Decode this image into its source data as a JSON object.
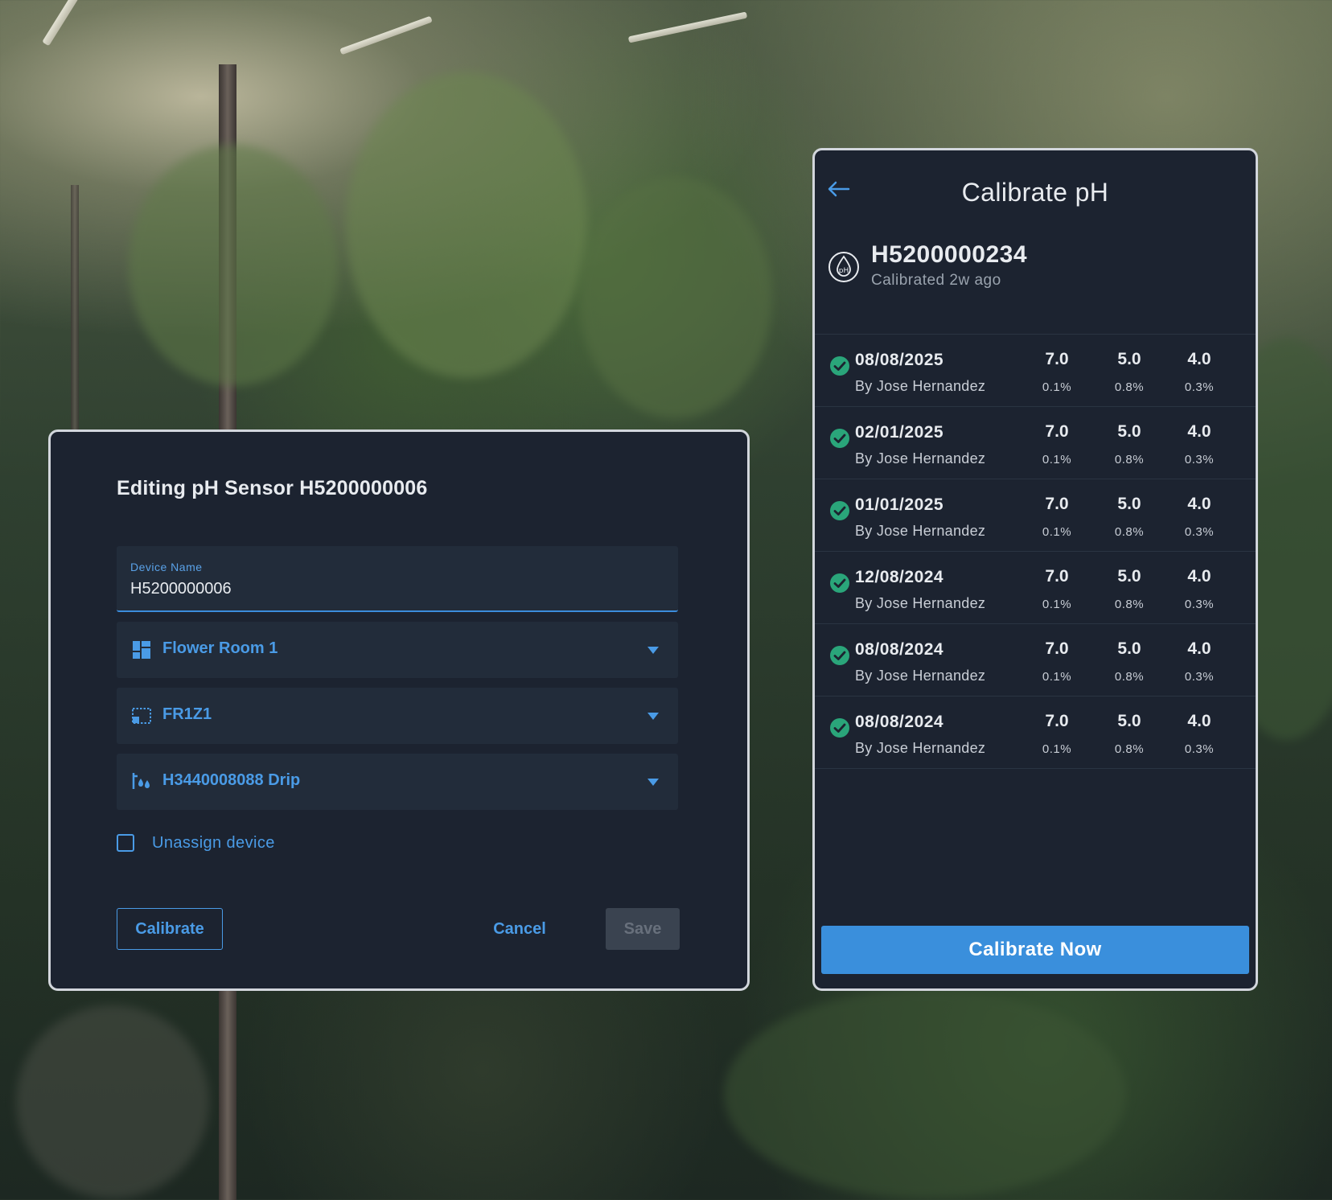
{
  "edit_dialog": {
    "title": "Editing pH Sensor H5200000006",
    "device_name": {
      "label": "Device Name",
      "value": "H5200000006"
    },
    "selects": [
      {
        "icon": "room-grid-icon",
        "value": "Flower Room 1"
      },
      {
        "icon": "zone-icon",
        "value": "FR1Z1"
      },
      {
        "icon": "drip-irrigation-icon",
        "value": "H3440008088 Drip"
      }
    ],
    "unassign_label": "Unassign device",
    "unassign_checked": false,
    "buttons": {
      "calibrate": "Calibrate",
      "cancel": "Cancel",
      "save": "Save"
    }
  },
  "calibrate_panel": {
    "title": "Calibrate pH",
    "device": {
      "icon": "ph-sensor-icon",
      "id": "H5200000234",
      "subtitle": "Calibrated 2w ago"
    },
    "rows": [
      {
        "date": "08/08/2025",
        "by": "By Jose Hernandez",
        "points": [
          {
            "ph": "7.0",
            "dev": "0.1%"
          },
          {
            "ph": "5.0",
            "dev": "0.8%"
          },
          {
            "ph": "4.0",
            "dev": "0.3%"
          }
        ]
      },
      {
        "date": "02/01/2025",
        "by": "By Jose Hernandez",
        "points": [
          {
            "ph": "7.0",
            "dev": "0.1%"
          },
          {
            "ph": "5.0",
            "dev": "0.8%"
          },
          {
            "ph": "4.0",
            "dev": "0.3%"
          }
        ]
      },
      {
        "date": "01/01/2025",
        "by": "By Jose Hernandez",
        "points": [
          {
            "ph": "7.0",
            "dev": "0.1%"
          },
          {
            "ph": "5.0",
            "dev": "0.8%"
          },
          {
            "ph": "4.0",
            "dev": "0.3%"
          }
        ]
      },
      {
        "date": "12/08/2024",
        "by": "By Jose Hernandez",
        "points": [
          {
            "ph": "7.0",
            "dev": "0.1%"
          },
          {
            "ph": "5.0",
            "dev": "0.8%"
          },
          {
            "ph": "4.0",
            "dev": "0.3%"
          }
        ]
      },
      {
        "date": "08/08/2024",
        "by": "By Jose Hernandez",
        "points": [
          {
            "ph": "7.0",
            "dev": "0.1%"
          },
          {
            "ph": "5.0",
            "dev": "0.8%"
          },
          {
            "ph": "4.0",
            "dev": "0.3%"
          }
        ]
      },
      {
        "date": "08/08/2024",
        "by": "By Jose Hernandez",
        "points": [
          {
            "ph": "7.0",
            "dev": "0.1%"
          },
          {
            "ph": "5.0",
            "dev": "0.8%"
          },
          {
            "ph": "4.0",
            "dev": "0.3%"
          }
        ]
      }
    ],
    "calibrate_now": "Calibrate Now"
  },
  "colors": {
    "panel_bg": "#1c2330",
    "field_bg": "#222c3a",
    "accent": "#4a9be6",
    "primary_button": "#3a8fdc",
    "success": "#2aa57a"
  }
}
